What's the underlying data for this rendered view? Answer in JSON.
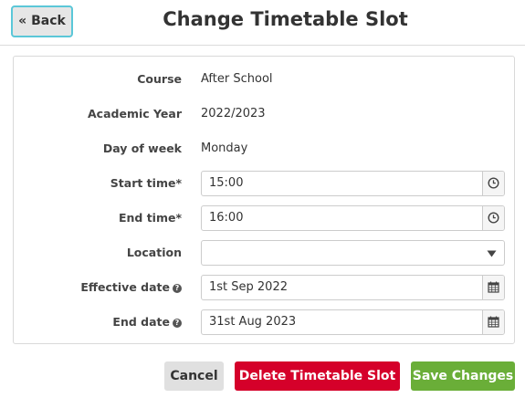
{
  "header": {
    "back_label": "« Back",
    "title": "Change Timetable Slot"
  },
  "form": {
    "course": {
      "label": "Course",
      "value": "After School"
    },
    "academic_year": {
      "label": "Academic Year",
      "value": "2022/2023"
    },
    "day_of_week": {
      "label": "Day of week",
      "value": "Monday"
    },
    "start_time": {
      "label": "Start time*",
      "value": "15:00",
      "icon": "clock-icon"
    },
    "end_time": {
      "label": "End time*",
      "value": "16:00",
      "icon": "clock-icon"
    },
    "location": {
      "label": "Location",
      "value": "",
      "icon": "caret-down-icon"
    },
    "effective_date": {
      "label": "Effective date",
      "value": "1st Sep 2022",
      "icon": "calendar-icon",
      "help_icon": "question-circle-icon"
    },
    "end_date": {
      "label": "End date",
      "value": "31st Aug 2023",
      "icon": "calendar-icon",
      "help_icon": "question-circle-icon"
    }
  },
  "actions": {
    "cancel_label": "Cancel",
    "delete_label": "Delete Timetable Slot »",
    "save_label": "Save Changes"
  },
  "colors": {
    "back_border": "#5bc7d8",
    "delete": "#d5002a",
    "save": "#6aae38",
    "cancel": "#e0e0e0"
  }
}
